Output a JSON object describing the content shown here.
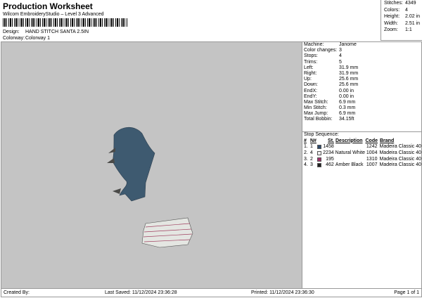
{
  "header": {
    "title": "Production Worksheet",
    "subtitle": "Wilcom EmbroideryStudio – Level 3 Advanced",
    "design_label": "Design:",
    "design": "HAND STITCH SANTA 2.5IN",
    "colorway_label": "Colorway:",
    "colorway": "Colorway 1"
  },
  "summary": [
    {
      "k": "Stitches:",
      "v": "4349"
    },
    {
      "k": "Colors:",
      "v": "4"
    },
    {
      "k": "Height:",
      "v": "2.02 in"
    },
    {
      "k": "Width:",
      "v": "2.51 in"
    },
    {
      "k": "Zoom:",
      "v": "1:1"
    }
  ],
  "details": [
    {
      "k": "Machine:",
      "v": "Janome"
    },
    {
      "k": "Color changes:",
      "v": "3"
    },
    {
      "k": "Stops:",
      "v": "4"
    },
    {
      "k": "Trims:",
      "v": "5"
    },
    {
      "k": "Left:",
      "v": "31.9 mm"
    },
    {
      "k": "Right:",
      "v": "31.9 mm"
    },
    {
      "k": "Up:",
      "v": "25.6 mm"
    },
    {
      "k": "Down:",
      "v": "25.6 mm"
    },
    {
      "k": "EndX:",
      "v": "0.00 in"
    },
    {
      "k": "EndY:",
      "v": "0.00 in"
    },
    {
      "k": "Max Stitch:",
      "v": "6.9 mm"
    },
    {
      "k": "Min Stitch:",
      "v": "0.3 mm"
    },
    {
      "k": "Max Jump:",
      "v": "6.9 mm"
    },
    {
      "k": "Total Bobbin:",
      "v": "34.15ft"
    }
  ],
  "stop_sequence": {
    "title": "Stop Sequence:",
    "headers": [
      "#",
      "N#",
      "St.",
      "Description",
      "Code",
      "Brand"
    ],
    "rows": [
      {
        "n": "1.",
        "nn": "1",
        "color": "#2e4a6b",
        "st": "1458",
        "desc": "",
        "code": "1242",
        "brand": "Madeira Classic 40"
      },
      {
        "n": "2.",
        "nn": "4",
        "color": "#eeeeee",
        "st": "2234",
        "desc": "Natural White",
        "code": "1004",
        "brand": "Madeira Classic 40"
      },
      {
        "n": "3.",
        "nn": "2",
        "color": "#a0306a",
        "st": "195",
        "desc": "",
        "code": "1310",
        "brand": "Madeira Classic 40"
      },
      {
        "n": "4.",
        "nn": "3",
        "color": "#222222",
        "st": "462",
        "desc": "Amber Black",
        "code": "1007",
        "brand": "Madeira Classic 40"
      }
    ]
  },
  "footer": {
    "created": "Created By:",
    "saved": "Last Saved: 11/12/2024 23:36:28",
    "printed": "Printed: 11/12/2024 23:36:30",
    "page": "Page 1 of 1"
  }
}
